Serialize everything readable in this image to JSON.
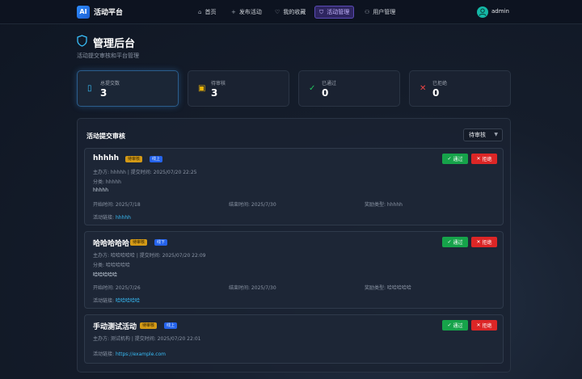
{
  "nav": {
    "logo": "AI",
    "brand": "活动平台",
    "items": [
      {
        "label": "首页",
        "icon": "⌂"
      },
      {
        "label": "发布活动",
        "icon": "+"
      },
      {
        "label": "我的收藏",
        "icon": "♡"
      },
      {
        "label": "活动管理",
        "icon": "⛉"
      },
      {
        "label": "用户管理",
        "icon": "⚇"
      }
    ],
    "active_index": 3,
    "user": "admin"
  },
  "header": {
    "title": "管理后台",
    "subtitle": "活动提交审核和平台管理"
  },
  "stats": [
    {
      "label": "总提交数",
      "value": "3",
      "icon": "▯",
      "color": "#38bdf8"
    },
    {
      "label": "待审核",
      "value": "3",
      "icon": "▣",
      "color": "#eab308"
    },
    {
      "label": "已通过",
      "value": "0",
      "icon": "✓",
      "color": "#22c55e"
    },
    {
      "label": "已拒绝",
      "value": "0",
      "icon": "✕",
      "color": "#ef4444"
    }
  ],
  "review": {
    "title": "活动提交审核",
    "filter": "待审核",
    "approve_label": "通过",
    "reject_label": "拒绝",
    "cards": [
      {
        "title": "hhhhh",
        "status": "待审核",
        "mode": "线上",
        "meta": "主办方: hhhhh | 提交时间: 2025/07/20 22:25",
        "category": "分类: hhhhh",
        "desc": "hhhhh",
        "start": "开始时间: 2025/7/18",
        "end": "结束时间: 2025/7/30",
        "reward": "奖励类型: hhhhh",
        "link_label": "活动链接:",
        "link": "hhhhh"
      },
      {
        "title": "哈哈哈哈哈",
        "status": "待审核",
        "mode": "线下",
        "meta": "主办方: 哈哈哈哈哈 | 提交时间: 2025/07/20 22:09",
        "category": "分类: 哈哈哈哈哈",
        "desc": "哈哈哈哈哈",
        "start": "开始时间: 2025/7/26",
        "end": "结束时间: 2025/7/30",
        "reward": "奖励类型: 哈哈哈哈哈",
        "link_label": "活动链接:",
        "link": "哈哈哈哈哈"
      },
      {
        "title": "手动测试活动",
        "status": "待审核",
        "mode": "线上",
        "meta": "主办方: 测试机构 | 提交时间: 2025/07/20 22:01",
        "link_label": "活动链接:",
        "link": "https://example.com"
      }
    ]
  },
  "colors": {
    "accent": "#2563eb",
    "approve": "#16a34a",
    "reject": "#dc2626",
    "pending": "#d49a16"
  }
}
